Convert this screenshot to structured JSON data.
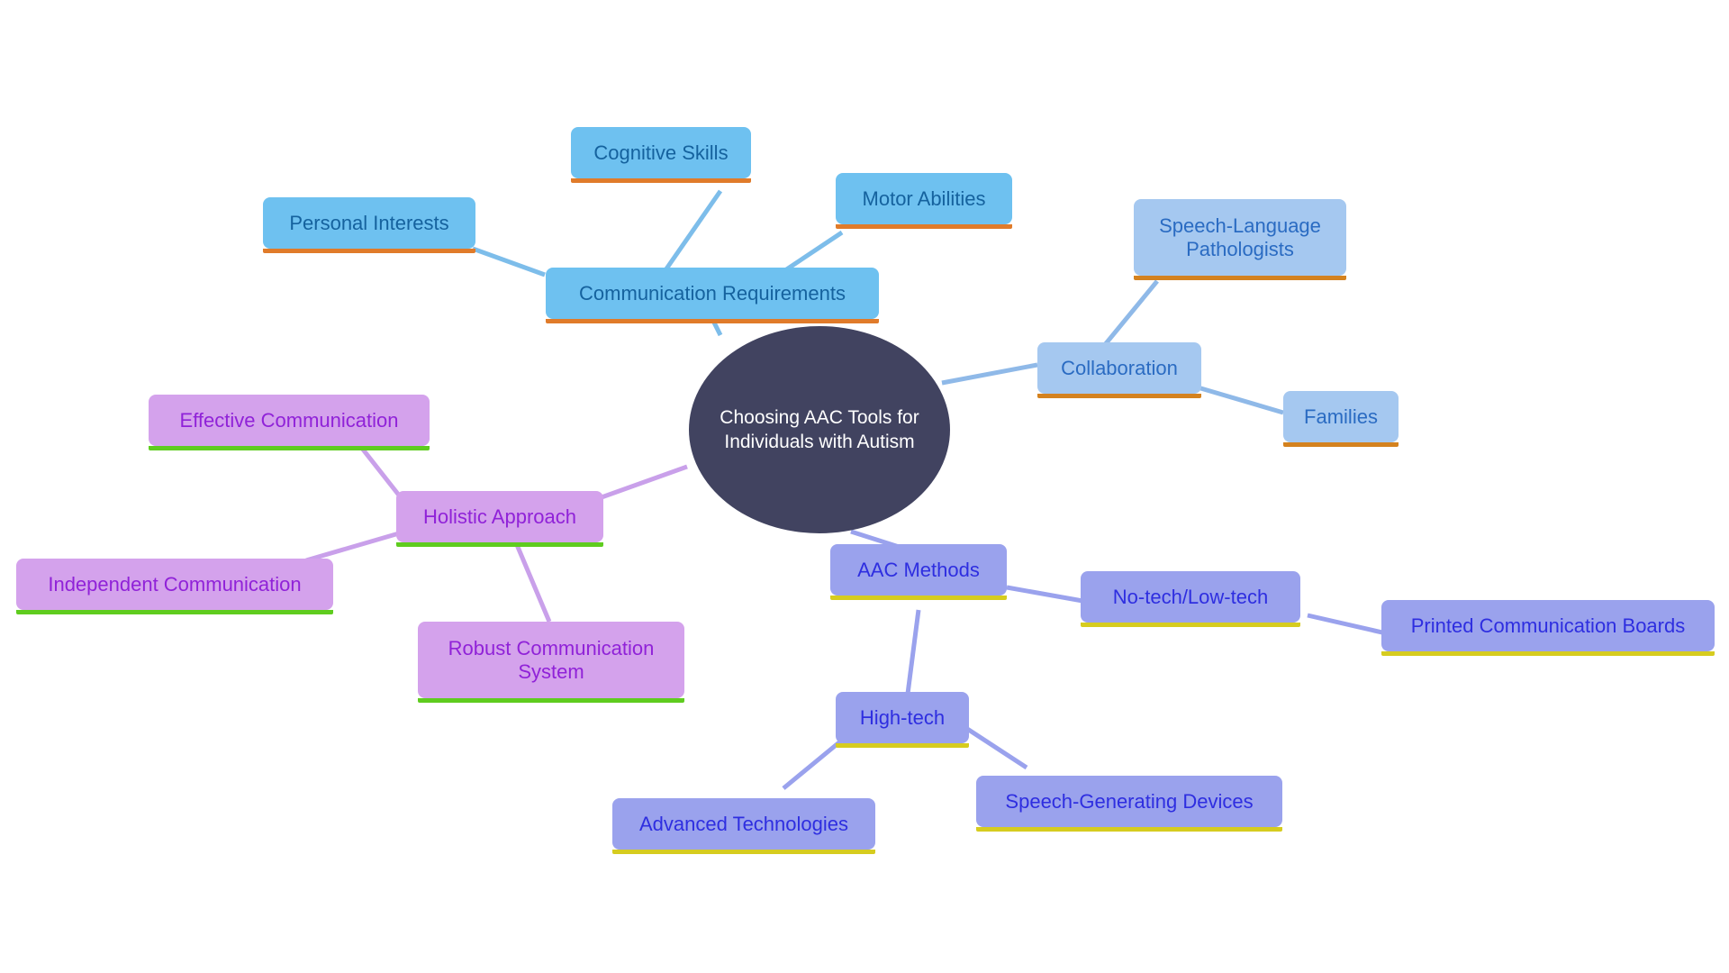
{
  "diagram": {
    "title": "Choosing AAC Tools for Individuals with Autism",
    "type": "mind-map",
    "background_color": "#ffffff"
  },
  "palette": {
    "center_fill": "#414360",
    "center_text": "#ffffff",
    "blue_fill": "#6ec1f0",
    "blue_text": "#15629e",
    "blue_underline": "#e07b2a",
    "lightblue_fill": "#a5c8f0",
    "lightblue_text": "#2a6bc2",
    "lightblue_underline": "#d4821f",
    "purple_fill": "#d4a2ec",
    "purple_text": "#9022d8",
    "purple_underline": "#5fcc1f",
    "indigo_fill": "#9aa2ed",
    "indigo_text": "#2e2ee0",
    "indigo_underline": "#d6cc1f",
    "edge_blue": "#7dbdea",
    "edge_lightblue": "#8fb9e8",
    "edge_purple": "#c9a0ea",
    "edge_indigo": "#9aa2ed"
  },
  "center": {
    "label": "Choosing AAC Tools for\nIndividuals with Autism"
  },
  "branches": [
    {
      "name": "communication-requirements",
      "color_group": "blue",
      "root": {
        "label": "Communication Requirements"
      },
      "children": [
        {
          "label": "Cognitive Skills"
        },
        {
          "label": "Personal Interests"
        },
        {
          "label": "Motor Abilities"
        }
      ]
    },
    {
      "name": "collaboration",
      "color_group": "lightblue",
      "root": {
        "label": "Collaboration"
      },
      "children": [
        {
          "label": "Speech-Language\nPathologists"
        },
        {
          "label": "Families"
        }
      ]
    },
    {
      "name": "holistic-approach",
      "color_group": "purple",
      "root": {
        "label": "Holistic Approach"
      },
      "children": [
        {
          "label": "Effective Communication"
        },
        {
          "label": "Independent Communication"
        },
        {
          "label": "Robust Communication\nSystem"
        }
      ]
    },
    {
      "name": "aac-methods",
      "color_group": "indigo",
      "root": {
        "label": "AAC Methods"
      },
      "children": [
        {
          "label": "No-tech/Low-tech"
        },
        {
          "label": "Printed Communication Boards"
        },
        {
          "label": "High-tech"
        },
        {
          "label": "Advanced Technologies"
        },
        {
          "label": "Speech-Generating Devices"
        }
      ]
    }
  ],
  "nodes": {
    "cognitive_skills": "Cognitive Skills",
    "personal_interests": "Personal Interests",
    "motor_abilities": "Motor Abilities",
    "communication_requirements": "Communication Requirements",
    "speech_language_pathologists": "Speech-Language\nPathologists",
    "collaboration": "Collaboration",
    "families": "Families",
    "effective_communication": "Effective Communication",
    "holistic_approach": "Holistic Approach",
    "independent_communication": "Independent Communication",
    "robust_communication_system": "Robust Communication\nSystem",
    "aac_methods": "AAC Methods",
    "no_tech_low_tech": "No-tech/Low-tech",
    "printed_communication_boards": "Printed Communication Boards",
    "high_tech": "High-tech",
    "advanced_technologies": "Advanced Technologies",
    "speech_generating_devices": "Speech-Generating Devices"
  }
}
